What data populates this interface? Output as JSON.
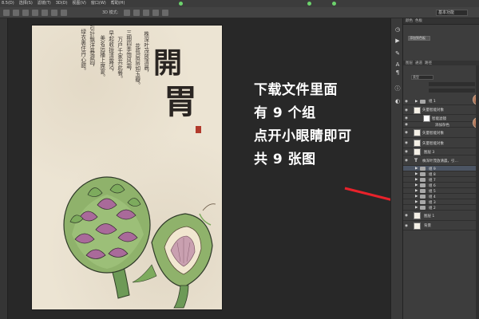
{
  "menubar": {
    "items": [
      "8.5(D)",
      "选择(S)",
      "滤镜(T)",
      "3D(D)",
      "视图(V)",
      "窗口(W)",
      "帮助(H)"
    ]
  },
  "optbar": {
    "mode": "3D 模式:",
    "workspace": "基本功能"
  },
  "poster": {
    "title_chars": [
      "開",
      "胃"
    ],
    "poem_columns": [
      "株深叶茂放清晨，",
      "花苞层层如玉瓣。",
      "三期四季饱风霜，",
      "万户千家共此餐。",
      "早起收拢清露沾，",
      "美名远播上席宴。",
      "引针飘洋暮游园，",
      "绿衣裹住丹心甜。"
    ]
  },
  "note": {
    "lines": [
      "下载文件里面",
      "有 9 个组",
      "点开小眼睛即可",
      "共 9 张图"
    ]
  },
  "right_panel": {
    "top_tabs": [
      "颜色",
      "色板"
    ],
    "swatch_button": "添加到色板",
    "layers_tabs": [
      "图层",
      "通道",
      "路径"
    ],
    "filter_label": "类型",
    "layers": [
      {
        "name": "组 1",
        "type": "group"
      },
      {
        "name": "矢量智能对象",
        "type": "smart"
      },
      {
        "name": "智能滤镜",
        "type": "filter"
      },
      {
        "name": "添加杂色",
        "type": "filter-item"
      },
      {
        "name": "矢量智能对象",
        "type": "smart"
      },
      {
        "name": "矢量智能对象",
        "type": "smart"
      },
      {
        "name": "图层 3",
        "type": "layer"
      },
      {
        "name": "株深叶茂放清晨，引…",
        "type": "text"
      },
      {
        "name": "组 9",
        "type": "group"
      },
      {
        "name": "组 8",
        "type": "group"
      },
      {
        "name": "组 7",
        "type": "group"
      },
      {
        "name": "组 6",
        "type": "group"
      },
      {
        "name": "组 5",
        "type": "group"
      },
      {
        "name": "组 4",
        "type": "group"
      },
      {
        "name": "组 3",
        "type": "group"
      },
      {
        "name": "组 2",
        "type": "group"
      },
      {
        "name": "图层 1",
        "type": "layer"
      },
      {
        "name": "背景",
        "type": "bg"
      }
    ]
  },
  "colors": {
    "arrow": "#e8222b",
    "canvas_bg": "#ece4d3",
    "workspace_bg": "#282828"
  }
}
